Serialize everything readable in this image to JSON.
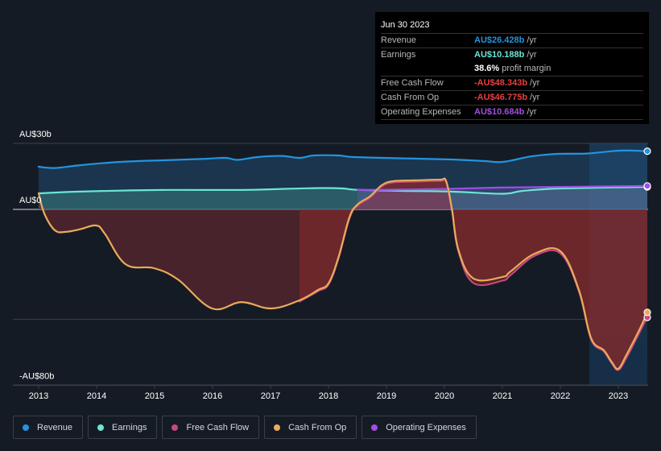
{
  "tooltip": {
    "date": "Jun 30 2023",
    "rows": [
      {
        "label": "Revenue",
        "value": "AU$26.428b",
        "unit": "/yr",
        "color": "#2394df"
      },
      {
        "label": "Earnings",
        "value": "AU$10.188b",
        "unit": "/yr",
        "color": "#6ce5d4"
      },
      {
        "label": "",
        "value": "38.6%",
        "unit": "profit margin",
        "color": "#ffffff"
      },
      {
        "label": "Free Cash Flow",
        "value": "-AU$48.343b",
        "unit": "/yr",
        "color": "#e6403f"
      },
      {
        "label": "Cash From Op",
        "value": "-AU$46.775b",
        "unit": "/yr",
        "color": "#e6403f"
      },
      {
        "label": "Operating Expenses",
        "value": "AU$10.684b",
        "unit": "/yr",
        "color": "#a04ee7"
      }
    ]
  },
  "chart_data": {
    "type": "area",
    "title": "",
    "xlabel": "",
    "ylabel": "",
    "ylim": [
      -80,
      30
    ],
    "xlim": [
      2013.0,
      2023.5
    ],
    "y_ticks": [
      {
        "value": 30,
        "label": "AU$30b"
      },
      {
        "value": 0,
        "label": "AU$0"
      },
      {
        "value": -80,
        "label": "-AU$80b"
      }
    ],
    "y_gridlines": [
      30,
      0,
      -50,
      -80
    ],
    "x_ticks": [
      2013,
      2014,
      2015,
      2016,
      2017,
      2018,
      2019,
      2020,
      2021,
      2022,
      2023
    ],
    "highlight_range": [
      2022.5,
      2023.5
    ],
    "legend_position": "bottom",
    "series": [
      {
        "name": "Revenue",
        "color": "#2394df",
        "points": [
          [
            2013.0,
            19.4
          ],
          [
            2013.28,
            18.8
          ],
          [
            2013.72,
            20.1
          ],
          [
            2014.42,
            21.6
          ],
          [
            2015.11,
            22.3
          ],
          [
            2015.81,
            22.9
          ],
          [
            2016.22,
            23.4
          ],
          [
            2016.43,
            22.5
          ],
          [
            2016.78,
            23.8
          ],
          [
            2017.19,
            24.3
          ],
          [
            2017.5,
            23.4
          ],
          [
            2017.75,
            24.5
          ],
          [
            2018.17,
            24.5
          ],
          [
            2018.44,
            23.8
          ],
          [
            2019.28,
            23.2
          ],
          [
            2020.11,
            22.7
          ],
          [
            2020.67,
            22.0
          ],
          [
            2021.01,
            21.6
          ],
          [
            2021.5,
            24.1
          ],
          [
            2021.92,
            25.2
          ],
          [
            2022.47,
            25.4
          ],
          [
            2023.03,
            26.7
          ],
          [
            2023.5,
            26.428
          ]
        ]
      },
      {
        "name": "Earnings",
        "color": "#6ce5d4",
        "points": [
          [
            2013.0,
            7.3
          ],
          [
            2013.72,
            8.1
          ],
          [
            2015.11,
            8.8
          ],
          [
            2016.5,
            8.8
          ],
          [
            2017.19,
            9.3
          ],
          [
            2017.89,
            9.7
          ],
          [
            2018.25,
            9.5
          ],
          [
            2018.5,
            8.9
          ],
          [
            2019.28,
            8.4
          ],
          [
            2020.11,
            8.1
          ],
          [
            2021.0,
            7.1
          ],
          [
            2021.35,
            8.4
          ],
          [
            2022.0,
            9.5
          ],
          [
            2023.5,
            10.188
          ]
        ]
      },
      {
        "name": "Free Cash Flow",
        "color": "#c9477e",
        "points": [
          [
            2017.5,
            -41.3
          ],
          [
            2017.82,
            -36.6
          ],
          [
            2018.0,
            -33.6
          ],
          [
            2018.17,
            -22.0
          ],
          [
            2018.36,
            -3.7
          ],
          [
            2018.5,
            2.2
          ],
          [
            2018.72,
            6.0
          ],
          [
            2018.92,
            11.0
          ],
          [
            2019.11,
            12.8
          ],
          [
            2019.5,
            13.2
          ],
          [
            2019.92,
            13.5
          ],
          [
            2020.03,
            12.8
          ],
          [
            2020.13,
            0.0
          ],
          [
            2020.24,
            -18.3
          ],
          [
            2020.5,
            -32.9
          ],
          [
            2021.0,
            -31.8
          ],
          [
            2021.14,
            -29.3
          ],
          [
            2021.56,
            -20.5
          ],
          [
            2022.0,
            -19.4
          ],
          [
            2022.32,
            -36.6
          ],
          [
            2022.53,
            -58.5
          ],
          [
            2022.75,
            -64.0
          ],
          [
            2022.89,
            -69.5
          ],
          [
            2023.0,
            -72.4
          ],
          [
            2023.14,
            -66.9
          ],
          [
            2023.36,
            -55.6
          ],
          [
            2023.5,
            -48.343
          ]
        ]
      },
      {
        "name": "Cash From Op",
        "color": "#e9ab5b",
        "points": [
          [
            2013.0,
            7.3
          ],
          [
            2013.1,
            -2.0
          ],
          [
            2013.28,
            -9.5
          ],
          [
            2013.47,
            -10.2
          ],
          [
            2013.72,
            -9.0
          ],
          [
            2013.99,
            -7.3
          ],
          [
            2014.14,
            -11.0
          ],
          [
            2014.5,
            -24.9
          ],
          [
            2014.99,
            -26.7
          ],
          [
            2015.4,
            -31.8
          ],
          [
            2015.99,
            -45.0
          ],
          [
            2016.5,
            -42.1
          ],
          [
            2017.01,
            -45.0
          ],
          [
            2017.5,
            -41.3
          ],
          [
            2017.82,
            -36.6
          ],
          [
            2018.0,
            -33.6
          ],
          [
            2018.17,
            -22.0
          ],
          [
            2018.36,
            -3.7
          ],
          [
            2018.5,
            2.2
          ],
          [
            2018.72,
            6.0
          ],
          [
            2018.92,
            11.0
          ],
          [
            2019.11,
            12.8
          ],
          [
            2019.5,
            13.2
          ],
          [
            2019.92,
            13.5
          ],
          [
            2020.03,
            12.8
          ],
          [
            2020.13,
            0.0
          ],
          [
            2020.24,
            -18.3
          ],
          [
            2020.5,
            -31.4
          ],
          [
            2021.0,
            -30.7
          ],
          [
            2021.14,
            -28.2
          ],
          [
            2021.56,
            -20.1
          ],
          [
            2022.0,
            -19.0
          ],
          [
            2022.32,
            -36.6
          ],
          [
            2022.53,
            -58.5
          ],
          [
            2022.75,
            -64.0
          ],
          [
            2022.89,
            -69.5
          ],
          [
            2023.0,
            -72.4
          ],
          [
            2023.14,
            -66.1
          ],
          [
            2023.36,
            -54.9
          ],
          [
            2023.5,
            -46.775
          ]
        ]
      },
      {
        "name": "Operating Expenses",
        "color": "#a04ee7",
        "points": [
          [
            2018.5,
            8.8
          ],
          [
            2019.28,
            9.0
          ],
          [
            2020.0,
            9.3
          ],
          [
            2020.94,
            9.9
          ],
          [
            2022.0,
            10.2
          ],
          [
            2023.5,
            10.684
          ]
        ]
      }
    ]
  },
  "legend": [
    {
      "label": "Revenue",
      "color": "#2394df"
    },
    {
      "label": "Earnings",
      "color": "#6ce5d4"
    },
    {
      "label": "Free Cash Flow",
      "color": "#c9477e"
    },
    {
      "label": "Cash From Op",
      "color": "#e9ab5b"
    },
    {
      "label": "Operating Expenses",
      "color": "#a04ee7"
    }
  ]
}
